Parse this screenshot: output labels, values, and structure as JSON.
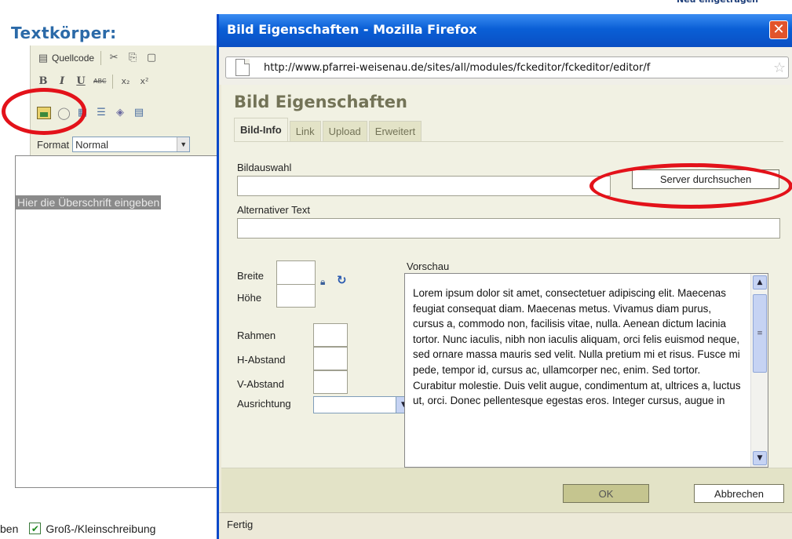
{
  "background_editor": {
    "heading": "Textkörper:",
    "top_right_text": "Neu eingetragen",
    "toolbar": {
      "source_label": "Quellcode",
      "format_label": "Format",
      "format_value": "Normal",
      "icons": [
        "source-icon",
        "cut-icon",
        "copy-icon",
        "paste-icon",
        "bold-icon",
        "italic-icon",
        "underline-icon",
        "strikethrough-icon",
        "subscript-icon",
        "superscript-icon",
        "image-icon",
        "flash-icon",
        "table-icon",
        "rule-icon",
        "smiley-icon",
        "special-char-icon"
      ]
    },
    "placeholder": "Hier die Überschrift eingeben",
    "status_prefix": "ben",
    "checkbox_label": "Groß-/Kleinschreibung",
    "checkbox_checked": true
  },
  "popup": {
    "window_title": "Bild Eigenschaften - Mozilla Firefox",
    "url": "http://www.pfarrei-weisenau.de/sites/all/modules/fckeditor/fckeditor/editor/f",
    "dialog_title": "Bild Eigenschaften",
    "tabs": [
      {
        "label": "Bild-Info",
        "active": true
      },
      {
        "label": "Link",
        "active": false
      },
      {
        "label": "Upload",
        "active": false
      },
      {
        "label": "Erweitert",
        "active": false
      }
    ],
    "fields": {
      "bildauswahl_label": "Bildauswahl",
      "bildauswahl_value": "",
      "server_button": "Server durchsuchen",
      "alt_text_label": "Alternativer Text",
      "alt_text_value": "",
      "breite_label": "Breite",
      "hoehe_label": "Höhe",
      "rahmen_label": "Rahmen",
      "h_abstand_label": "H-Abstand",
      "v_abstand_label": "V-Abstand",
      "ausrichtung_label": "Ausrichtung",
      "ausrichtung_value": ""
    },
    "preview": {
      "label": "Vorschau",
      "text": "Lorem ipsum dolor sit amet, consectetuer adipiscing elit. Maecenas feugiat consequat diam. Maecenas metus. Vivamus diam purus, cursus a, commodo non, facilisis vitae, nulla. Aenean dictum lacinia tortor. Nunc iaculis, nibh non iaculis aliquam, orci felis euismod neque, sed ornare massa mauris sed velit. Nulla pretium mi et risus. Fusce mi pede, tempor id, cursus ac, ullamcorper nec, enim. Sed tortor. Curabitur molestie. Duis velit augue, condimentum at, ultrices a, luctus ut, orci. Donec pellentesque egestas eros. Integer cursus, augue in"
    },
    "ok_button": "OK",
    "cancel_button": "Abbrechen",
    "status": "Fertig"
  },
  "annotation_color": "#e3121a"
}
